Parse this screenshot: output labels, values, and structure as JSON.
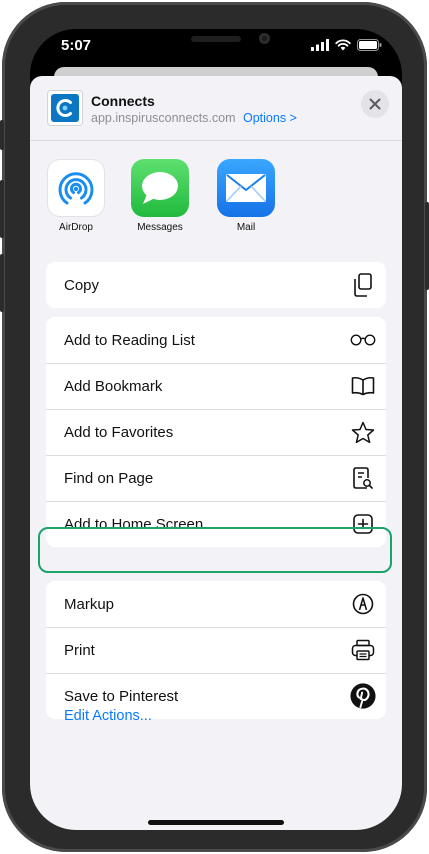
{
  "status_bar": {
    "time": "5:07"
  },
  "header": {
    "title": "Connects",
    "url": "app.inspirusconnects.com",
    "options_label": "Options >"
  },
  "share_apps": [
    {
      "label": "AirDrop",
      "icon": "airdrop-icon"
    },
    {
      "label": "Messages",
      "icon": "messages-icon"
    },
    {
      "label": "Mail",
      "icon": "mail-icon"
    }
  ],
  "actions": {
    "group1": [
      {
        "label": "Copy",
        "icon": "copy-icon"
      }
    ],
    "group2": [
      {
        "label": "Add to Reading List",
        "icon": "glasses-icon"
      },
      {
        "label": "Add Bookmark",
        "icon": "book-icon"
      },
      {
        "label": "Add to Favorites",
        "icon": "star-icon"
      },
      {
        "label": "Find on Page",
        "icon": "find-page-icon"
      },
      {
        "label": "Add to Home Screen",
        "icon": "plus-square-icon"
      }
    ],
    "group3": [
      {
        "label": "Markup",
        "icon": "markup-icon"
      },
      {
        "label": "Print",
        "icon": "printer-icon"
      },
      {
        "label": "Save to Pinterest",
        "icon": "pinterest-icon"
      }
    ]
  },
  "edit_actions_label": "Edit Actions...",
  "colors": {
    "accent": "#0a7aff",
    "highlight": "#1aa36b",
    "messages_green": "#34c759",
    "mail_blue": "#1f8cf5"
  }
}
